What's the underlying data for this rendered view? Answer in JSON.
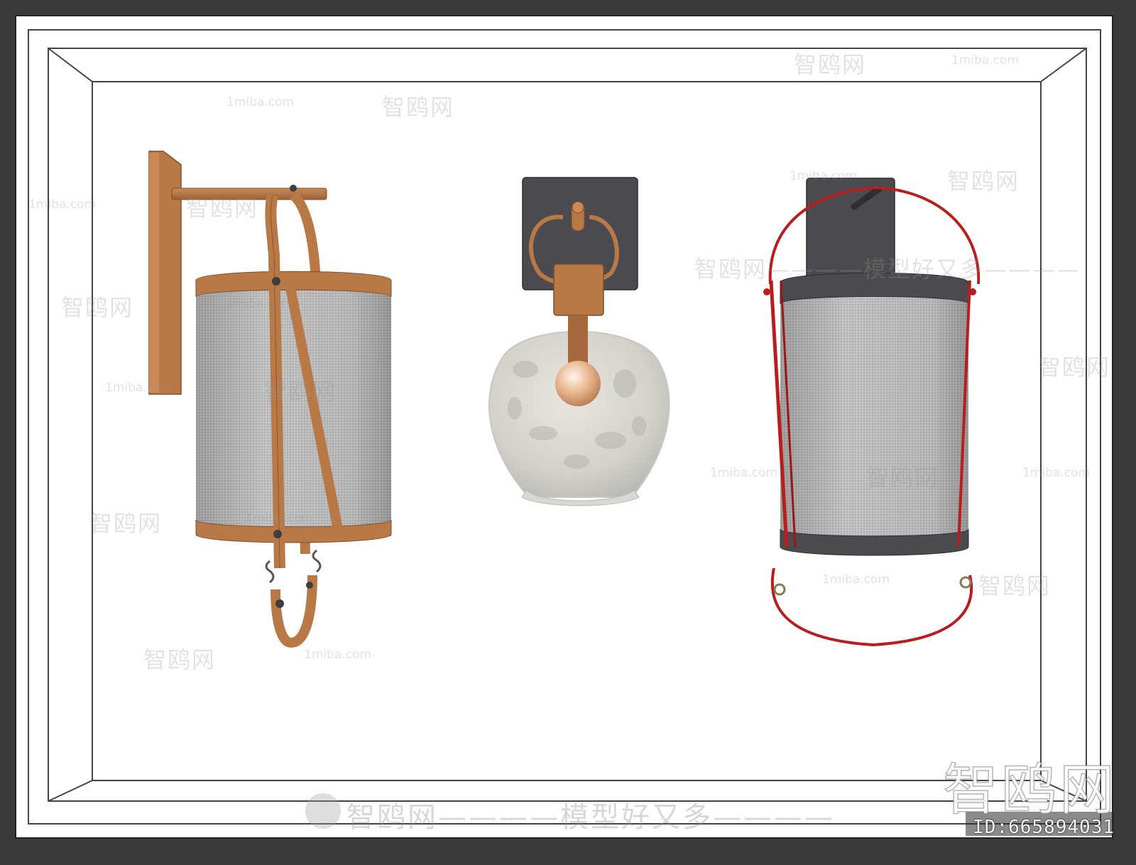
{
  "watermarks": {
    "site": "1miba.com",
    "brand": "智鸥网",
    "dash_long": "————",
    "slogan_line": "智鸥网————模型好又多————",
    "bottom_line": "智鸥网————模型好又多————",
    "big_mark": "智鸥网"
  },
  "id_label": "ID:665894031",
  "colors": {
    "frame_outer": "#3a3a3a",
    "canvas": "#ffffff",
    "leather": "#b87946",
    "leather_dark": "#8a5530",
    "fabric": "#bdbdbd",
    "metal_dark": "#4b4b4f",
    "red_strap": "#b81e1e",
    "glass": "#d8d8d2"
  },
  "objects": {
    "left_lamp": "leather-strap-wall-lamp",
    "center_lamp": "glass-globe-wall-lamp",
    "right_lamp": "red-strap-drum-wall-lamp"
  }
}
